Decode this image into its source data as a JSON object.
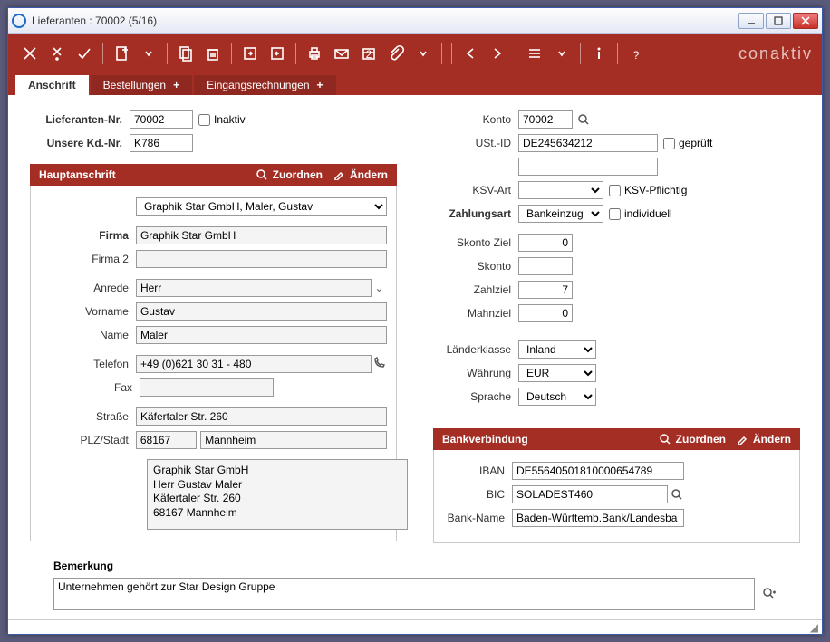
{
  "window": {
    "title": "Lieferanten : 70002 (5/16)"
  },
  "brand": "conaktiv",
  "tabs": [
    {
      "label": "Anschrift",
      "active": true
    },
    {
      "label": "Bestellungen",
      "active": false,
      "plus": true
    },
    {
      "label": "Eingangsrechnungen",
      "active": false,
      "plus": true
    }
  ],
  "labels": {
    "lieferanten_nr": "Lieferanten-Nr.",
    "inaktiv": "Inaktiv",
    "unsere_kdnr": "Unsere Kd.-Nr.",
    "hauptanschrift": "Hauptanschrift",
    "zuordnen": "Zuordnen",
    "aendern": "Ändern",
    "firma": "Firma",
    "firma2": "Firma 2",
    "anrede": "Anrede",
    "vorname": "Vorname",
    "name": "Name",
    "telefon": "Telefon",
    "fax": "Fax",
    "strasse": "Straße",
    "plz_stadt": "PLZ/Stadt",
    "konto": "Konto",
    "ust_id": "USt.-ID",
    "geprueft": "geprüft",
    "ksv_art": "KSV-Art",
    "ksv_pflichtig": "KSV-Pflichtig",
    "zahlungsart": "Zahlungsart",
    "individuell": "individuell",
    "skonto_ziel": "Skonto Ziel",
    "skonto": "Skonto",
    "zahlziel": "Zahlziel",
    "mahnziel": "Mahnziel",
    "laenderklasse": "Länderklasse",
    "waehrung": "Währung",
    "sprache": "Sprache",
    "bankverbindung": "Bankverbindung",
    "iban": "IBAN",
    "bic": "BIC",
    "bank_name": "Bank-Name",
    "bemerkung": "Bemerkung"
  },
  "left": {
    "lieferanten_nr": "70002",
    "inaktiv": false,
    "unsere_kdnr": "K786",
    "kontakt_selected": "Graphik Star GmbH, Maler, Gustav",
    "firma": "Graphik Star GmbH",
    "firma2": "",
    "anrede": "Herr",
    "vorname": "Gustav",
    "name": "Maler",
    "telefon": "+49 (0)621 30 31 - 480",
    "fax": "",
    "strasse": "Käfertaler Str. 260",
    "plz": "68167",
    "stadt": "Mannheim",
    "adresse_block": "Graphik Star GmbH\nHerr Gustav Maler\nKäfertaler Str. 260\n68167 Mannheim"
  },
  "right": {
    "konto": "70002",
    "ust_id": "DE245634212",
    "geprueft": false,
    "ksv_art": "",
    "ksv_pflichtig": false,
    "zahlungsart": "Bankeinzug",
    "individuell": false,
    "skonto_ziel": "0",
    "skonto": "",
    "zahlziel": "7",
    "mahnziel": "0",
    "laenderklasse": "Inland",
    "waehrung": "EUR",
    "sprache": "Deutsch",
    "iban": "DE55640501810000654789",
    "bic": "SOLADEST460",
    "bank_name": "Baden-Württemb.Bank/Landesba"
  },
  "bemerkung": "Unternehmen gehört zur Star Design Gruppe"
}
